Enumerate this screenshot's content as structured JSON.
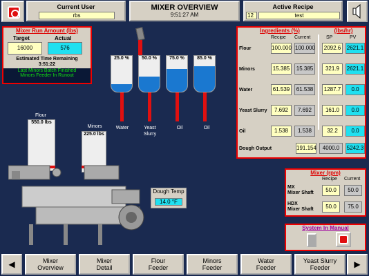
{
  "header": {
    "user_label": "Current User",
    "user_value": "rbs",
    "title": "MIXER OVERVIEW",
    "time": "9:51:27 AM",
    "recipe_label": "Active Recipe",
    "recipe_no": "12",
    "recipe_name": "test"
  },
  "run": {
    "title": "Mixer Run Amount (lbs)",
    "target_label": "Target",
    "actual_label": "Actual",
    "target": "16000",
    "actual": "576",
    "est_label": "Estimated Time Remaining",
    "est": "3:51:22",
    "msg1": "Last Minors Batch Finished",
    "msg2": "Minors Feeder In Runout"
  },
  "tanks": [
    {
      "pct": "25.0 %",
      "name": "Water",
      "level": 0.25
    },
    {
      "pct": "50.0 %",
      "name": "Yeast\nSlurry",
      "level": 0.5
    },
    {
      "pct": "75.0 %",
      "name": "Oil",
      "level": 0.75
    },
    {
      "pct": "85.0 %",
      "name": "Oil",
      "level": 0.85
    }
  ],
  "tank_names": {
    "t0": "Water",
    "t1a": "Yeast",
    "t1b": "Slurry",
    "t2": "Oil",
    "t3": "Oil"
  },
  "hoppers": {
    "flour_label": "Flour",
    "flour_value": "550.0 lbs",
    "minors_label": "Minors",
    "minors_value": "225.0 lbs"
  },
  "dough": {
    "label": "Dough Temp",
    "value": "14.0 °F"
  },
  "ingredients": {
    "title": "Ingredients (%)",
    "rate_title": "(lbs/hr)",
    "cols": [
      "Recipe",
      "Current",
      "SP",
      "PV"
    ],
    "rows": [
      {
        "name": "Flour",
        "recipe": "100.000",
        "current": "100.000",
        "sp": "2092.6",
        "pv": "2621.1"
      },
      {
        "name": "Minors",
        "recipe": "15.385",
        "current": "15.385",
        "sp": "321.9",
        "pv": "2621.1"
      },
      {
        "name": "Water",
        "recipe": "61.539",
        "current": "61.538",
        "sp": "1287.7",
        "pv": "0.0"
      },
      {
        "name": "Yeast Slurry",
        "recipe": "7.692",
        "current": "7.692",
        "sp": "161.0",
        "pv": "0.0"
      },
      {
        "name": "Oil",
        "recipe": "1.538",
        "current": "1.538",
        "sp": "32.2",
        "pv": "0.0"
      }
    ],
    "output_label": "Dough Output",
    "output_recipe": "191.154",
    "output_sp": "4000.0",
    "output_pv": "5242.3"
  },
  "mixer": {
    "title": "Mixer (rpm)",
    "recipe_col": "Recipe",
    "current_col": "Current",
    "r1a": "MX",
    "r1b": "Mixer Shaft",
    "r1_recipe": "50.0",
    "r1_current": "50.0",
    "r2a": "HDX",
    "r2b": "Mixer Shaft",
    "r2_recipe": "50.0",
    "r2_current": "75.0"
  },
  "manual": {
    "title": "System In Manual"
  },
  "nav": [
    {
      "l1": "Mixer",
      "l2": "Overview"
    },
    {
      "l1": "Mixer",
      "l2": "Detail"
    },
    {
      "l1": "Flour",
      "l2": "Feeder"
    },
    {
      "l1": "Minors",
      "l2": "Feeder"
    },
    {
      "l1": "Water",
      "l2": "Feeder"
    },
    {
      "l1": "Yeast Slurry",
      "l2": "Feeder"
    }
  ],
  "colors": {
    "accent_red": "#e01010",
    "cyan": "#20e0f0",
    "yellow": "#ffffc0",
    "bg": "#1a2a50"
  }
}
